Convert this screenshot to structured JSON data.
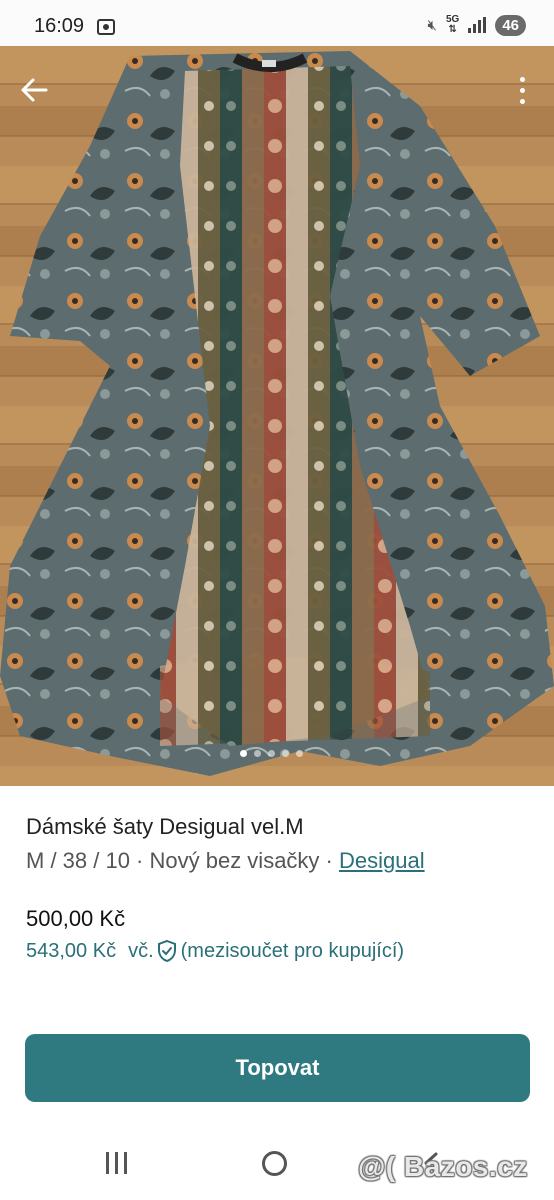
{
  "status_bar": {
    "time": "16:09",
    "network": "5G",
    "battery": "46",
    "icons": [
      "screen-record-icon",
      "mute-icon",
      "5g-icon",
      "signal-icon"
    ]
  },
  "gallery": {
    "image_count": 5,
    "active_index": 0,
    "colors": {
      "floor": "#b88a58",
      "dress": "#5c6b6c"
    }
  },
  "listing": {
    "title": "Dámské šaty Desigual vel.M",
    "meta_prefix": "M / 38 / 10 · Nový bez visačky · ",
    "brand": "Desigual",
    "price": "500,00 Kč",
    "buyer_price": "543,00 Kč",
    "buyer_price_prefix": "vč.",
    "buyer_price_note": "(mezisoučet pro kupující)"
  },
  "actions": {
    "primary_button": "Topovat"
  },
  "watermark": "@( Bazos.cz",
  "colors": {
    "accent": "#2f7a81",
    "link": "#2a7079"
  }
}
